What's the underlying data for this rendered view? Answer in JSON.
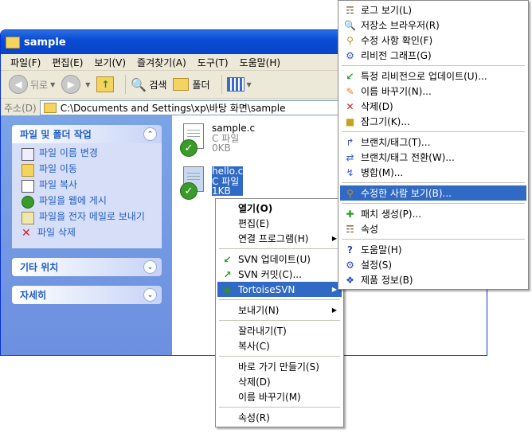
{
  "window": {
    "title": "sample"
  },
  "menubar": [
    "파일(F)",
    "편집(E)",
    "보기(V)",
    "즐겨찾기(A)",
    "도구(T)",
    "도움말(H)"
  ],
  "toolbar": {
    "back": "뒤로",
    "search": "검색",
    "folders": "폴더"
  },
  "address": {
    "label": "주소(D)",
    "path": "C:\\Documents and Settings\\xp\\바탕 화면\\sample"
  },
  "taskpane": {
    "file_tasks": {
      "title": "파일 및 폴더 작업",
      "items": [
        "파일 이름 변경",
        "파일 이동",
        "파일 복사",
        "파일을 웹에 게시",
        "파일을 전자 메일로 보내기",
        "파일 삭제"
      ]
    },
    "other_places": {
      "title": "기타 위치"
    },
    "details": {
      "title": "자세히"
    }
  },
  "files": [
    {
      "name": "sample.c",
      "type": "C 파일",
      "size": "0KB"
    },
    {
      "name": "hello.c",
      "type": "C 파일",
      "size": "1KB"
    }
  ],
  "context_menu": [
    {
      "label": "열기(O)",
      "bold": true
    },
    {
      "label": "편집(E)"
    },
    {
      "label": "연결 프로그램(H)",
      "submenu": true
    },
    {
      "sep": true
    },
    {
      "label": "SVN 업데이트(U)",
      "icon": "svn-update-icon"
    },
    {
      "label": "SVN 커밋(C)...",
      "icon": "svn-commit-icon"
    },
    {
      "label": "TortoiseSVN",
      "icon": "tortoise-icon",
      "submenu": true,
      "highlighted": true
    },
    {
      "sep": true
    },
    {
      "label": "보내기(N)",
      "submenu": true
    },
    {
      "sep": true
    },
    {
      "label": "잘라내기(T)"
    },
    {
      "label": "복사(C)"
    },
    {
      "sep": true
    },
    {
      "label": "바로 가기 만들기(S)"
    },
    {
      "label": "삭제(D)"
    },
    {
      "label": "이름 바꾸기(M)"
    },
    {
      "sep": true
    },
    {
      "label": "속성(R)"
    }
  ],
  "svn_submenu": [
    {
      "label": "로그 보기(L)",
      "icon": "log-icon"
    },
    {
      "label": "저장소 브라우저(R)",
      "icon": "repo-browser-icon"
    },
    {
      "label": "수정 사항 확인(F)",
      "icon": "check-modifications-icon"
    },
    {
      "label": "리비전 그래프(G)",
      "icon": "revision-graph-icon"
    },
    {
      "sep": true
    },
    {
      "label": "특정 리비전으로 업데이트(U)...",
      "icon": "update-to-revision-icon"
    },
    {
      "label": "이름 바꾸기(N)...",
      "icon": "rename-icon"
    },
    {
      "label": "삭제(D)",
      "icon": "delete-icon"
    },
    {
      "label": "잠그기(K)...",
      "icon": "lock-icon"
    },
    {
      "sep": true
    },
    {
      "label": "브랜치/태그(T)...",
      "icon": "branch-tag-icon"
    },
    {
      "label": "브랜치/태그 전환(W)...",
      "icon": "switch-icon"
    },
    {
      "label": "병합(M)...",
      "icon": "merge-icon"
    },
    {
      "sep": true
    },
    {
      "label": "수정한 사람 보기(B)...",
      "icon": "blame-icon",
      "highlighted": true
    },
    {
      "sep": true
    },
    {
      "label": "패치 생성(P)...",
      "icon": "create-patch-icon"
    },
    {
      "label": "속성",
      "icon": "properties-icon"
    },
    {
      "sep": true
    },
    {
      "label": "도움말(H)",
      "icon": "help-icon"
    },
    {
      "label": "설정(S)",
      "icon": "settings-icon"
    },
    {
      "label": "제품 정보(B)",
      "icon": "about-icon"
    }
  ]
}
